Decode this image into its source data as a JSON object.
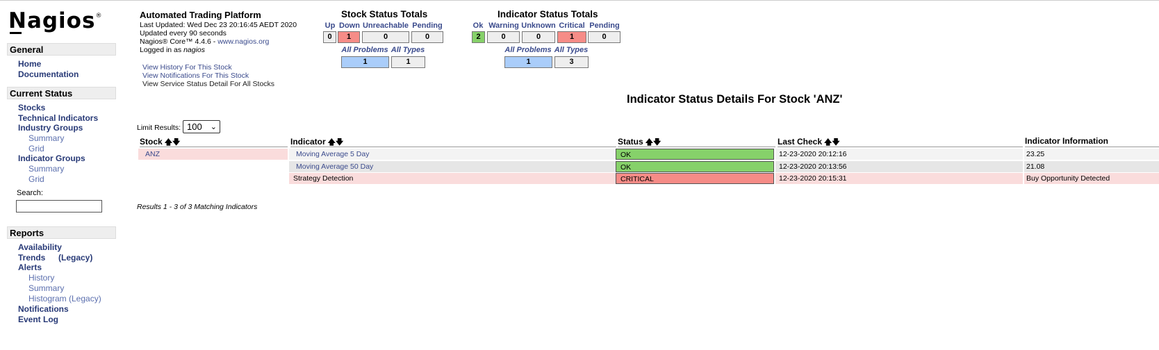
{
  "sidebar": {
    "logo": "Nagios",
    "logo_mark": "®",
    "sections": {
      "general": {
        "title": "General",
        "items": [
          "Home",
          "Documentation"
        ]
      },
      "current_status": {
        "title": "Current Status",
        "items": {
          "stocks": "Stocks",
          "technical_indicators": "Technical Indicators",
          "industry_groups": "Industry Groups",
          "ig_summary": "Summary",
          "ig_grid": "Grid",
          "indicator_groups": "Indicator Groups",
          "indg_summary": "Summary",
          "indg_grid": "Grid"
        }
      },
      "reports": {
        "title": "Reports",
        "items": {
          "availability": "Availability",
          "trends": "Trends",
          "trends_legacy": "(Legacy)",
          "alerts": "Alerts",
          "history": "History",
          "summary": "Summary",
          "histogram": "Histogram (Legacy)",
          "notifications": "Notifications",
          "event_log": "Event Log"
        }
      }
    },
    "search": {
      "label": "Search:",
      "value": ""
    }
  },
  "header": {
    "title": "Automated Trading Platform",
    "last_updated": "Last Updated: Wed Dec 23 20:16:45 AEDT 2020",
    "update_interval": "Updated every 90 seconds",
    "core_prefix": "Nagios® Core™ 4.4.6 - ",
    "core_link": "www.nagios.org",
    "logged_in_prefix": "Logged in as ",
    "logged_in_user": "nagios",
    "links": [
      "View History For This Stock",
      "View Notifications For This Stock"
    ],
    "plain_link": "View Service Status Detail For All Stocks"
  },
  "stock_totals": {
    "title": "Stock Status Totals",
    "headers": [
      "Up",
      "Down",
      "Unreachable",
      "Pending"
    ],
    "values": [
      "0",
      "1",
      "0",
      "0"
    ],
    "sub_headers": [
      "All Problems",
      "All Types"
    ],
    "sub_values": [
      "1",
      "1"
    ]
  },
  "indicator_totals": {
    "title": "Indicator Status Totals",
    "headers": [
      "Ok",
      "Warning",
      "Unknown",
      "Critical",
      "Pending"
    ],
    "values": [
      "2",
      "0",
      "0",
      "1",
      "0"
    ],
    "sub_headers": [
      "All Problems",
      "All Types"
    ],
    "sub_values": [
      "1",
      "3"
    ]
  },
  "page_title": "Indicator Status Details For Stock 'ANZ'",
  "limit": {
    "label": "Limit Results:",
    "value": "100"
  },
  "table": {
    "columns": [
      "Stock",
      "Indicator",
      "Status",
      "Last Check",
      "Indicator Information"
    ],
    "sort_glyph": "🡅🡇",
    "rows": [
      {
        "stock": "ANZ",
        "indicator": "Moving Average 5 Day",
        "status": "OK",
        "last_check": "12-23-2020 20:12:16",
        "info": "23.25"
      },
      {
        "stock": "",
        "indicator": "Moving Average 50 Day",
        "status": "OK",
        "last_check": "12-23-2020 20:13:56",
        "info": "21.08"
      },
      {
        "stock": "",
        "indicator": "Strategy Detection",
        "status": "CRITICAL",
        "last_check": "12-23-2020 20:15:31",
        "info": "Buy Opportunity Detected"
      }
    ],
    "results_text": "Results 1 - 3 of 3 Matching Indicators"
  },
  "colors": {
    "ok": "#86d16a",
    "critical": "#f68c87",
    "problem_row": "#fadcdc",
    "link": "#3a4a8c",
    "all_problems": "#aacdfa"
  }
}
